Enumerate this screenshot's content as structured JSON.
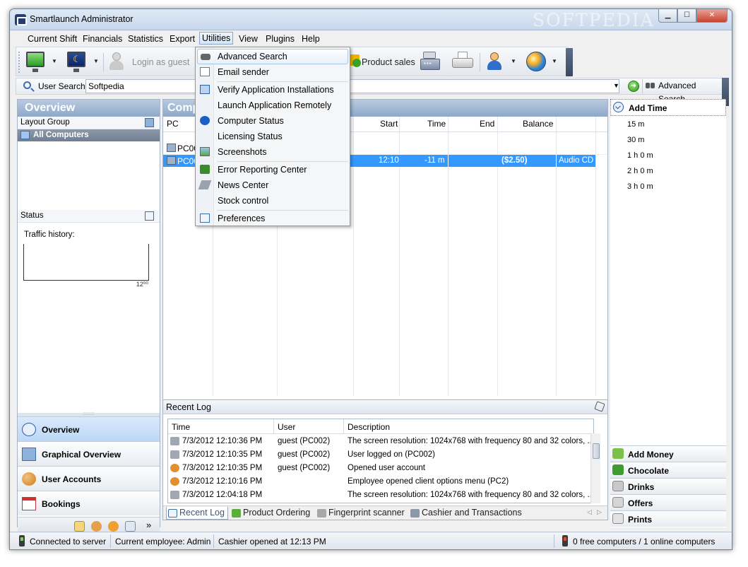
{
  "window": {
    "title": "Smartlaunch Administrator",
    "watermark": "SOFTPEDIA",
    "controls": {
      "minimize": "▁",
      "maximize": "☐",
      "close": "✕"
    }
  },
  "menubar": [
    "Current Shift",
    "Financials",
    "Statistics",
    "Export",
    "Utilities",
    "View",
    "Plugins",
    "Help"
  ],
  "toolbar": {
    "login_guest": "Login as guest",
    "product_sales": "Product sales"
  },
  "search": {
    "label": "User Search:",
    "value": "Softpedia",
    "advanced_label": "Advanced Search"
  },
  "left_panel": {
    "header": "Overview",
    "layout_group": "Layout Group",
    "all_computers": "All Computers",
    "status": "Status",
    "traffic_history": "Traffic history:",
    "graph_tick": "12⁰⁰",
    "grip": "::::::::::",
    "nav": [
      "Overview",
      "Graphical Overview",
      "User Accounts",
      "Bookings"
    ],
    "more": "»"
  },
  "center": {
    "header": "Comp",
    "columns": {
      "pc": "PC",
      "start": "Start",
      "time": "Time",
      "end": "End",
      "balance": "Balance"
    },
    "rows": [
      {
        "pc": "PC00",
        "start": "",
        "time": "",
        "end": "",
        "balance": "",
        "extra": ""
      },
      {
        "pc": "PC00",
        "start": "12:10",
        "time": "-11 m",
        "end": "",
        "balance": "($2.50)",
        "extra": "Audio CD"
      }
    ]
  },
  "right_panel": {
    "add_time": "Add Time",
    "time_choices": [
      "15 m",
      "30 m",
      "1 h 0 m",
      "2 h 0 m",
      "3 h 0 m"
    ],
    "buttons": [
      "Add Money",
      "Chocolate",
      "Drinks",
      "Offers",
      "Prints"
    ]
  },
  "recent_log": {
    "title": "Recent Log",
    "columns": {
      "time": "Time",
      "user": "User",
      "description": "Description"
    },
    "rows": [
      {
        "time": "7/3/2012 12:10:36 PM",
        "user": "guest (PC002)",
        "description": "The screen resolution: 1024x768 with frequency 80 and 32 colors, ..."
      },
      {
        "time": "7/3/2012 12:10:35 PM",
        "user": "guest (PC002)",
        "description": "User logged on (PC002)"
      },
      {
        "time": "7/3/2012 12:10:35 PM",
        "user": "guest (PC002)",
        "description": "Opened user account"
      },
      {
        "time": "7/3/2012 12:10:16 PM",
        "user": "",
        "description": "Employee opened client options menu (PC2)"
      },
      {
        "time": "7/3/2012 12:04:18 PM",
        "user": "",
        "description": "The screen resolution: 1024x768 with frequency 80 and 32 colors, ..."
      }
    ],
    "tabs": [
      "Recent Log",
      "Product Ordering",
      "Fingerprint scanner",
      "Cashier and Transactions"
    ]
  },
  "statusbar": {
    "connection": "Connected to server",
    "employee": "Current employee: Admin",
    "cashier": "Cashier opened at 12:13 PM",
    "computers": "0 free computers / 1 online computers"
  },
  "utilities_menu": {
    "items": [
      "Advanced Search",
      "Email sender",
      "Verify Application Installations",
      "Launch Application Remotely",
      "Computer Status",
      "Licensing Status",
      "Screenshots",
      "Error Reporting Center",
      "News Center",
      "Stock control",
      "Preferences"
    ],
    "hover_index": 0
  },
  "colors": {
    "selection": "#3399ff",
    "header_blue": "#8ea8c9"
  }
}
